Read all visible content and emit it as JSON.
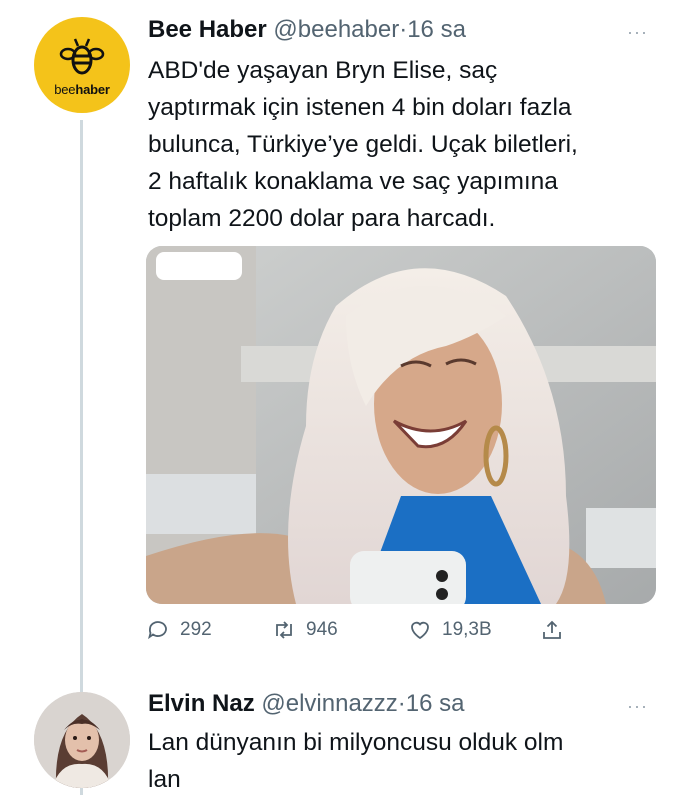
{
  "tweet1": {
    "name": "Bee Haber",
    "handle": "@beehaber",
    "separator": "·",
    "time": "16 sa",
    "more": "···",
    "avatar_text_a": "bee",
    "avatar_text_b": "haber",
    "lines": [
      "ABD'de yaşayan Bryn Elise, saç",
      "yaptırmak için istenen 4 bin doları fazla",
      "bulunca, Türkiye’ye geldi. Uçak biletleri,",
      "2 haftalık konaklama ve saç yapımına",
      "toplam 2200 dolar para harcadı."
    ],
    "stats": {
      "replies": "292",
      "retweets": "946",
      "likes": "19,3B"
    }
  },
  "tweet2": {
    "name": "Elvin Naz",
    "handle": "@elvinnazzz",
    "separator": "·",
    "time": "16 sa",
    "more": "···",
    "lines": [
      "Lan dünyanın bi milyoncusu olduk olm",
      "lan"
    ]
  },
  "icons": [
    "bee-logo-icon",
    "reply-icon",
    "retweet-icon",
    "like-icon",
    "share-icon",
    "more-icon"
  ],
  "colors": {
    "bee_yellow": "#f4c31a",
    "muted": "#536471",
    "thread": "#cfd9de"
  }
}
